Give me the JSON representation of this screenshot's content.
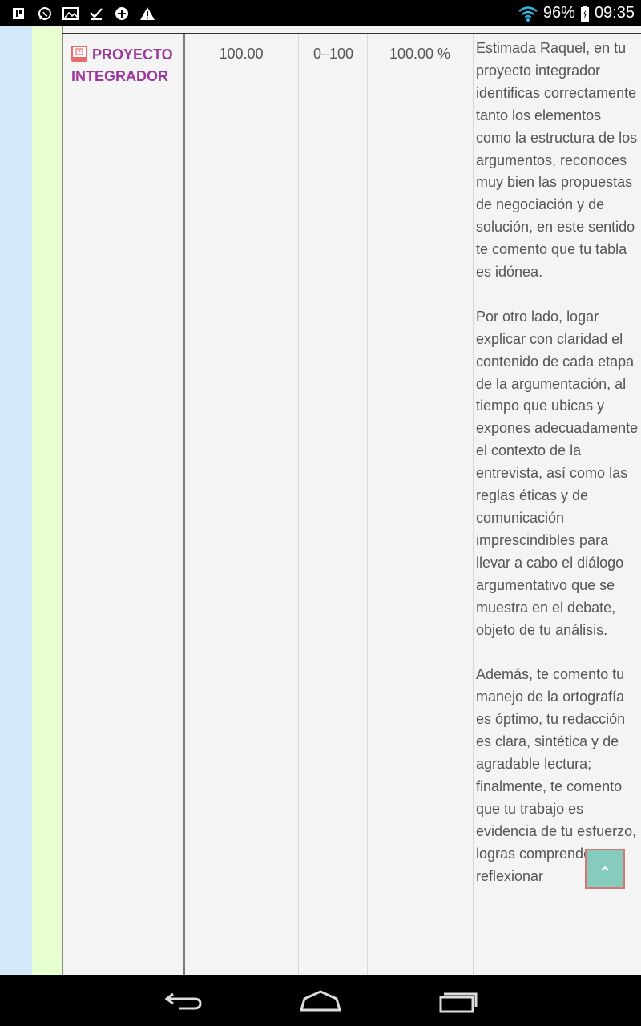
{
  "status_bar": {
    "left_icons": [
      "notification-icon",
      "whatsapp-icon",
      "gallery-icon",
      "task-done-icon",
      "gamepad-icon",
      "warning-icon"
    ],
    "battery": "96%",
    "time": "09:35"
  },
  "row": {
    "item_name": "PROYECTO INTEGRADOR",
    "grade": "100.00",
    "range": "0–100",
    "percentage": "100.00 %",
    "feedback": [
      "Estimada Raquel, en tu proyecto integrador identificas correctamente tanto los elementos como la estructura de los argumentos, reconoces muy bien las propuestas de negociación y de solución, en este sentido te comento que tu tabla es idónea.",
      "Por otro lado, logar explicar con claridad el contenido de cada etapa de la argumentación, al tiempo que ubicas y expones adecuadamente el contexto de la entrevista, así como las reglas éticas y de comunicación imprescindibles para llevar a cabo el diálogo argumentativo que se muestra en el debate, objeto de tu análisis.",
      "Además, te comento tu manejo de la ortografía es óptimo, tu redacción es clara, sintética y de agradable lectura; finalmente, te comento que tu trabajo es evidencia de tu esfuerzo, logras comprender y reflexionar"
    ]
  },
  "colors": {
    "link": "#9b3a9b",
    "scroll_top_bg": "#86ccbc",
    "scroll_top_border": "#d77676"
  }
}
